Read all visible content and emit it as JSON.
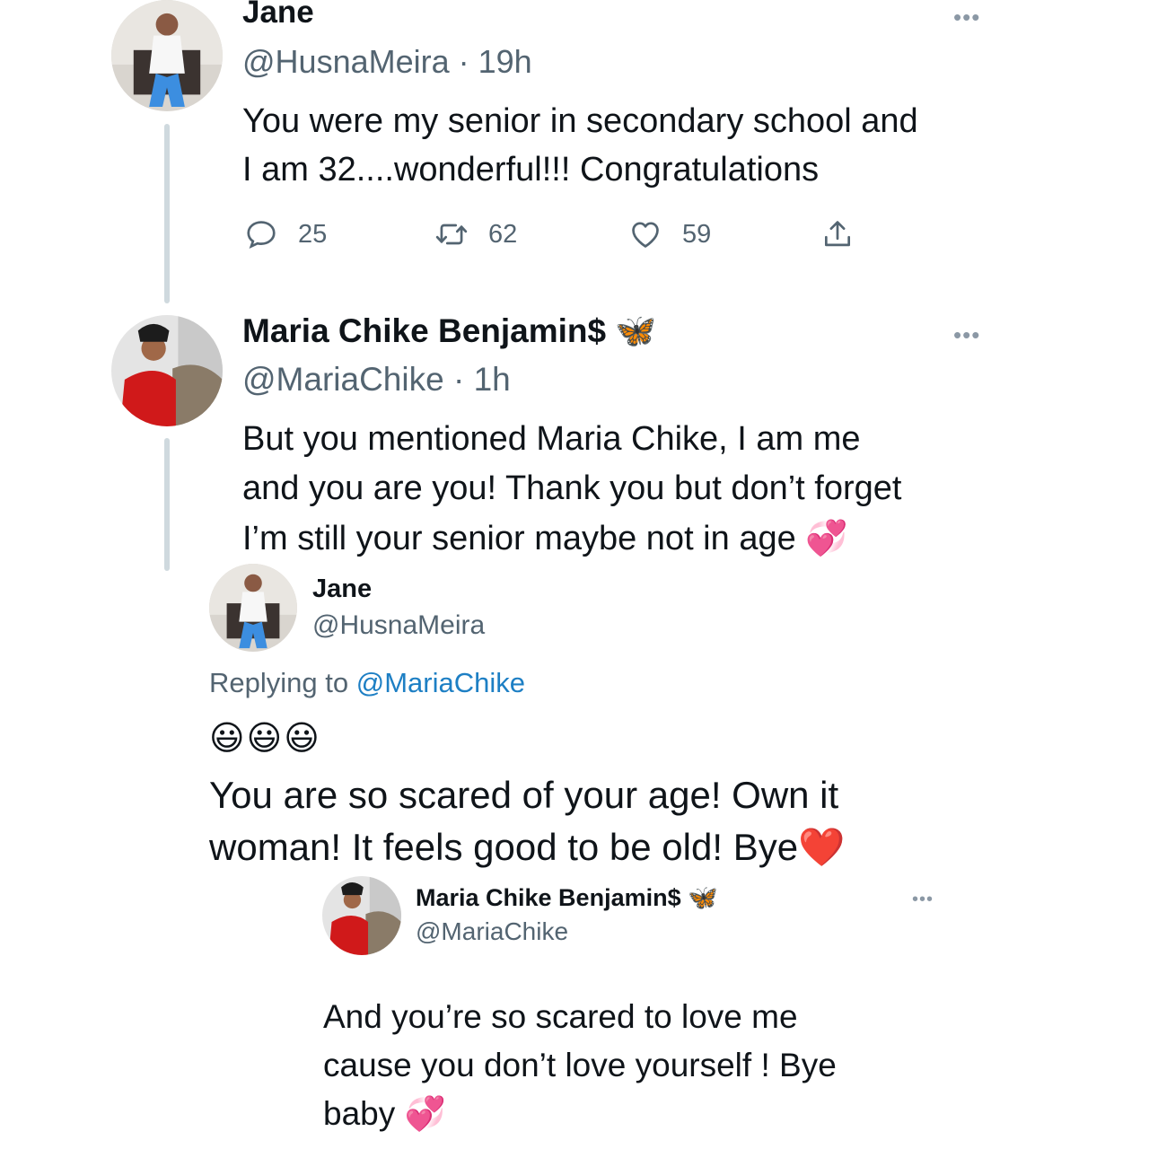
{
  "tweet1": {
    "name": "Jane",
    "handle": "@HusnaMeira",
    "time": "· 19h",
    "lines": [
      "You were my senior in secondary school and",
      "I am 32....wonderful!!! Congratulations"
    ],
    "actions": {
      "replies": "25",
      "retweets": "62",
      "likes": "59"
    },
    "more": "•••"
  },
  "tweet2": {
    "name": "Maria Chike Benjamin$",
    "badge_emoji": "🦋",
    "handle": "@MariaChike",
    "time": "· 1h",
    "lines": [
      "But you mentioned Maria Chike, I am me",
      "and you are you! Thank you but don’t forget",
      "I’m still your senior maybe not in age"
    ],
    "line3_emoji": "💞",
    "more": "•••"
  },
  "tweet3": {
    "name": "Jane",
    "handle": "@HusnaMeira",
    "replying_prefix": "Replying to",
    "replying_handle": "@MariaChike",
    "emoji_row": "😃😃😃",
    "lines": [
      "You are so scared of your age! Own it",
      "woman! It feels good to be old! Bye"
    ],
    "end_emoji": "❤️"
  },
  "tweet4": {
    "name": "Maria Chike Benjamin$",
    "badge_emoji": "🦋",
    "handle": "@MariaChike",
    "lines": [
      "And you’re so scared to love me",
      "cause you don’t love yourself ! Bye",
      "baby"
    ],
    "end_emoji": "💞",
    "more": "•••"
  },
  "colors": {
    "thread_line": "#cfd9de",
    "muted_text": "#536471",
    "link_blue": "#1d7fc4"
  }
}
